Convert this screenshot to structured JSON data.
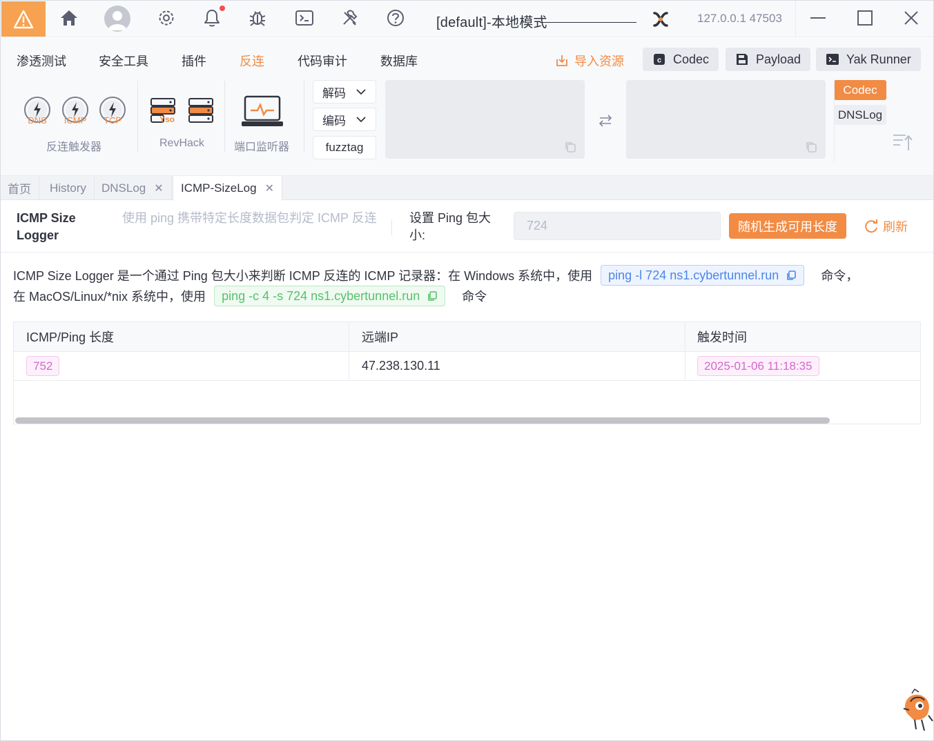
{
  "titlebar": {
    "engine_title": "[default]-本地模式",
    "host": "127.0.0.1 47503",
    "icons": [
      "warning-icon",
      "home-icon",
      "user-avatar-icon",
      "settings-icon",
      "bell-icon",
      "bug-icon",
      "terminal-icon",
      "tools-icon",
      "help-icon",
      "yak-logo-icon",
      "minimize-icon",
      "maximize-icon",
      "close-icon"
    ]
  },
  "menu": {
    "items": [
      "渗透测试",
      "安全工具",
      "插件",
      "反连",
      "代码审计",
      "数据库"
    ],
    "active": "反连",
    "import_label": "导入资源",
    "codec_btn": "Codec",
    "payload_btn": "Payload",
    "yakrunner_btn": "Yak Runner"
  },
  "tools": {
    "gauges": [
      "DNS",
      "ICMP",
      "TCP"
    ],
    "reverse_trigger_label": "反连触发器",
    "yso_label": "Yso",
    "revhack_label": "RevHack",
    "port_listener_label": "端口监听器",
    "decode_label": "解码",
    "encode_label": "编码",
    "fuzztag_label": "fuzztag",
    "side_tabs": [
      "Codec",
      "DNSLog"
    ]
  },
  "page_tabs": [
    {
      "label": "首页"
    },
    {
      "label": "History"
    },
    {
      "label": "DNSLog",
      "closable": true
    },
    {
      "label": "ICMP-SizeLog",
      "closable": true,
      "active": true
    }
  ],
  "header": {
    "title": "ICMP Size Logger",
    "description": "使用 ping 携带特定长度数据包判定 ICMP 反连",
    "size_label": "设置 Ping 包大小:",
    "size_value": "724",
    "generate_btn": "随机生成可用长度",
    "refresh_btn": "刷新"
  },
  "intro": {
    "line1_prefix": "ICMP Size Logger 是一个通过 Ping 包大小来判断 ICMP 反连的 ICMP 记录器：在 Windows 系统中，使用",
    "windows_cmd": "ping -l 724 ns1.cybertunnel.run",
    "line1_suffix": "命令，",
    "line2_prefix": "在 MacOS/Linux/*nix 系统中，使用",
    "unix_cmd": "ping -c 4 -s 724 ns1.cybertunnel.run",
    "line2_suffix": "命令"
  },
  "table": {
    "columns": [
      "ICMP/Ping 长度",
      "远端IP",
      "触发时间"
    ],
    "rows": [
      {
        "length": "752",
        "ip": "47.238.130.11",
        "time": "2025-01-06 11:18:35"
      }
    ]
  },
  "colors": {
    "accent": "#f28b44",
    "warning_bg": "#f6a250",
    "blue_chip": "#4a86e8",
    "green_chip": "#56c16c",
    "pink_tag": "#d468cc"
  }
}
